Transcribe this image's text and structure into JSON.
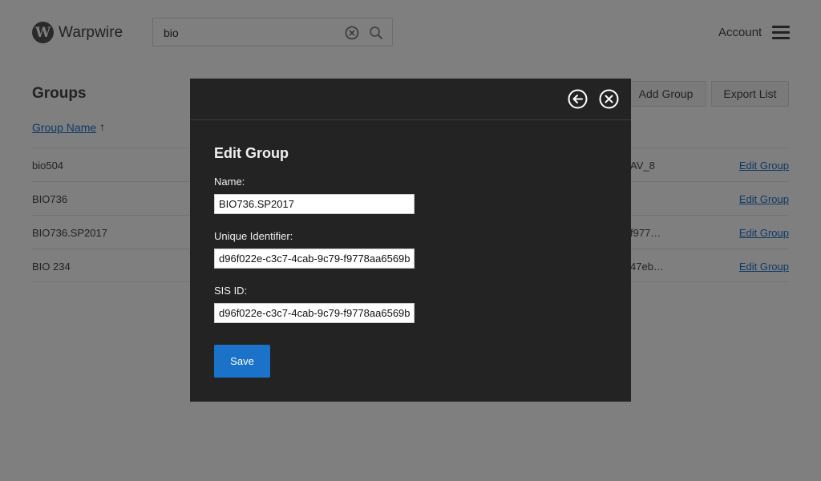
{
  "header": {
    "logo_letter": "W",
    "logo_text": "Warpwire",
    "search_value": "bio",
    "account_label": "Account"
  },
  "page": {
    "title": "Groups",
    "add_group_label": "Add Group",
    "export_list_label": "Export List",
    "column_group_name": "Group Name",
    "sort_indicator": "↑",
    "rows": [
      {
        "name": "bio504",
        "identifier": "AV_8",
        "edit_label": "Edit Group"
      },
      {
        "name": "BIO736",
        "identifier": "",
        "edit_label": "Edit Group"
      },
      {
        "name": "BIO736.SP2017",
        "identifier": "f977…",
        "edit_label": "Edit Group"
      },
      {
        "name": "BIO 234",
        "identifier": "47eb…",
        "edit_label": "Edit Group"
      }
    ]
  },
  "modal": {
    "title": "Edit Group",
    "name_label": "Name:",
    "name_value": "BIO736.SP2017",
    "unique_id_label": "Unique Identifier:",
    "unique_id_value": "d96f022e-c3c7-4cab-9c79-f9778aa6569b",
    "sis_id_label": "SIS ID:",
    "sis_id_value": "d96f022e-c3c7-4cab-9c79-f9778aa6569b",
    "save_label": "Save"
  },
  "colors": {
    "accent": "#1a73c8",
    "modal_bg": "#232323",
    "overlay": "rgba(0,0,0,0.5)"
  },
  "icons": {
    "logo": "warpwire-logo-icon",
    "clear": "clear-circle-x-icon",
    "search": "search-icon",
    "menu": "hamburger-menu-icon",
    "back": "back-arrow-circle-icon",
    "close": "close-circle-x-icon"
  }
}
